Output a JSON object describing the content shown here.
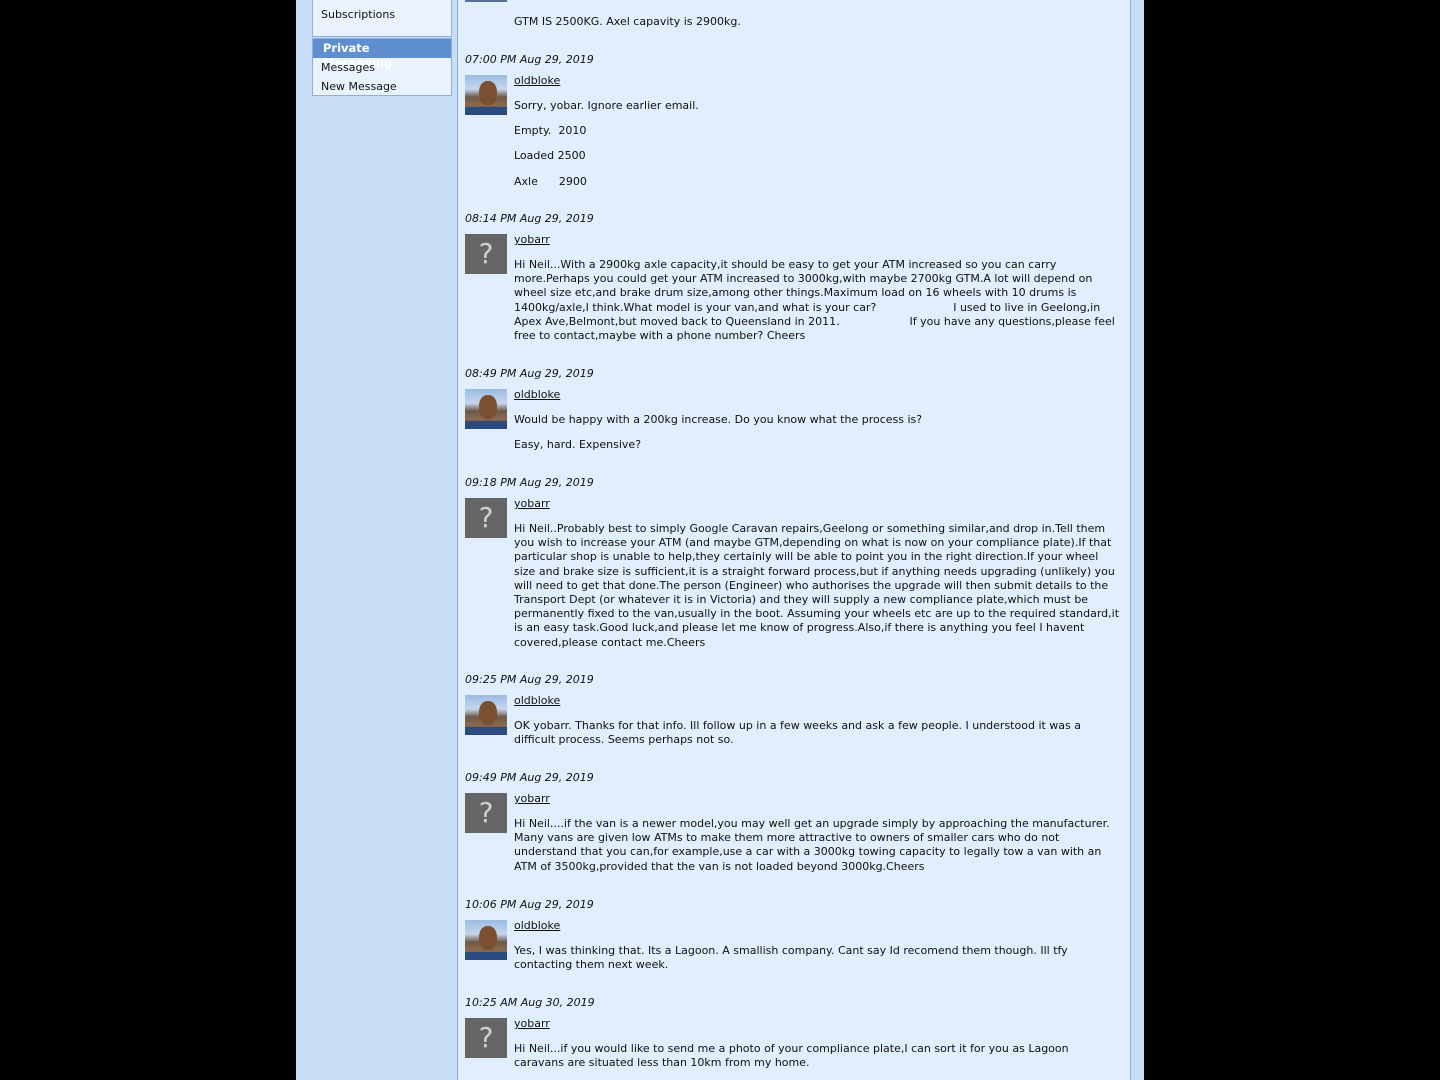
{
  "sidebar": {
    "subscriptions": "Subscriptions",
    "private_messaging_header": "Private Messaging",
    "messages": "Messages",
    "new_message": "New Message"
  },
  "top_fragment": {
    "text": "GTM IS 2500KG. Axel capavity is 2900kg."
  },
  "messages": [
    {
      "time": "07:00 PM Aug 29, 2019",
      "user": "oldbloke",
      "lines": [
        "Sorry, yobar. Ignore earlier email.",
        "Empty.  2010",
        "Loaded 2500",
        "Axle      2900"
      ]
    },
    {
      "time": "08:14 PM Aug 29, 2019",
      "user": "yobarr",
      "lines": [
        "Hi Neil...With a 2900kg axle capacity,it should be easy to get your ATM increased so you can carry more.Perhaps you could get your ATM increased to 3000kg,with maybe 2700kg GTM.A lot will depend on wheel size etc,and brake drum size,among other things.Maximum load on 16 wheels with 10 drums is 1400kg/axle,I think.What model is your van,and what is your car?                      I used to live in Geelong,in Apex Ave,Belmont,but moved back to Queensland in 2011.                    If you have any questions,please feel free to contact,maybe with a phone number? Cheers"
      ]
    },
    {
      "time": "08:49 PM Aug 29, 2019",
      "user": "oldbloke",
      "lines": [
        "Would be happy with a 200kg increase. Do you know what the process is?",
        "Easy, hard. Expensive?"
      ]
    },
    {
      "time": "09:18 PM Aug 29, 2019",
      "user": "yobarr",
      "lines": [
        "Hi Neil..Probably best to simply Google Caravan repairs,Geelong or something similar,and drop in.Tell them you wish to increase your ATM (and maybe GTM,depending on what is now on your compliance plate).If that particular shop is unable to help,they certainly will be able to point you in the right direction.If your wheel size and brake size is sufficient,it is a straight forward process,but if anything needs upgrading (unlikely) you will need to get that done.The person (Engineer) who authorises the upgrade will then submit details to the Transport Dept (or whatever it is in Victoria) and they will supply a new compliance plate,which must be permanently fixed to the van,usually in the boot. Assuming your wheels etc are up to the required standard,it is an easy task.Good luck,and please let me know of progress.Also,if there is anything you feel  I havent covered,please contact me.Cheers"
      ]
    },
    {
      "time": "09:25 PM Aug 29, 2019",
      "user": "oldbloke",
      "lines": [
        "OK yobarr. Thanks for that info. Ill follow up in a few weeks and ask a few people. I understood it was a difficult process. Seems perhaps not so."
      ]
    },
    {
      "time": "09:49 PM Aug 29, 2019",
      "user": "yobarr",
      "lines": [
        "Hi Neil....if the van is a newer model,you may well get an upgrade simply by approaching the manufacturer. Many vans are given low ATMs to make them more attractive to owners of smaller cars who do not understand that you can,for example,use a car with a 3000kg towing capacity to legally tow a van with an ATM of 3500kg,provided that the van is not loaded beyond 3000kg.Cheers"
      ]
    },
    {
      "time": "10:06 PM Aug 29, 2019",
      "user": "oldbloke",
      "lines": [
        "Yes, I was thinking that. Its a Lagoon. A smallish company. Cant say Id recomend them though. Ill tfy contacting them next week."
      ]
    },
    {
      "time": "10:25 AM Aug 30, 2019",
      "user": "yobarr",
      "lines": [
        "Hi Neil...if you would like to send me a photo of your compliance plate,I can sort it for you as Lagoon caravans are situated less than 10km from my home."
      ]
    }
  ],
  "avatar_unknown_glyph": "?"
}
